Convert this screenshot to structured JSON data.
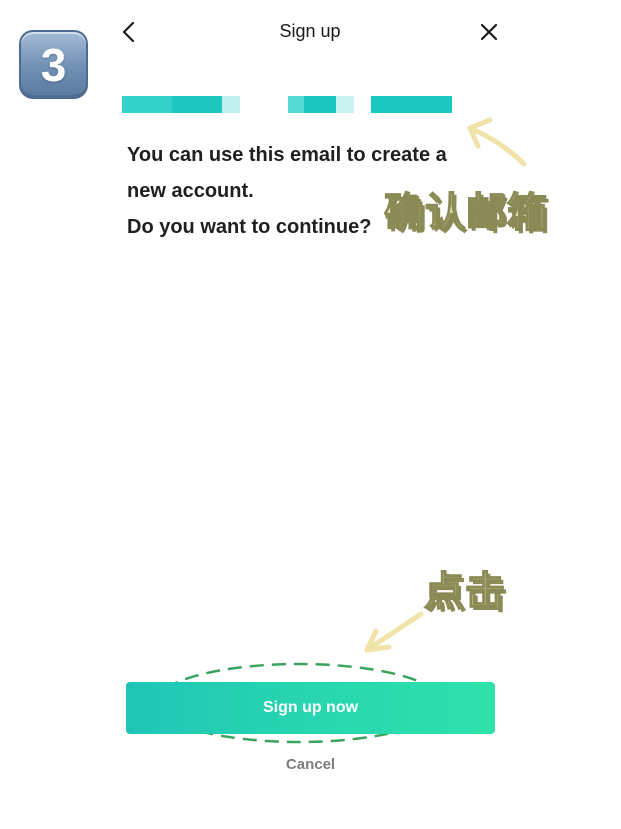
{
  "step": {
    "number": "3"
  },
  "header": {
    "title": "Sign up",
    "back_icon": "chevron-left-icon",
    "close_icon": "close-icon"
  },
  "email": {
    "masked": true,
    "mask_colors": [
      "#34d2cb",
      "#1cc7c1",
      "#bdf0ee",
      "#ffffff",
      "#55d9d3",
      "#17c6c0",
      "#c9f3f1",
      "#ffffff",
      "#1bc9c3"
    ]
  },
  "message": {
    "lines": [
      "You can use this email to create a",
      "new account.",
      "Do you want to continue?"
    ]
  },
  "annotations": {
    "confirm_email": "确认邮箱",
    "tap": "点击",
    "color_fill": "#e2eec0",
    "color_arrow": "#f0e3a8",
    "color_highlight": "#3aa35f"
  },
  "actions": {
    "signup_label": "Sign up now",
    "cancel_label": "Cancel",
    "button_gradient": [
      "#1fc6b5",
      "#2fe2aa"
    ]
  }
}
